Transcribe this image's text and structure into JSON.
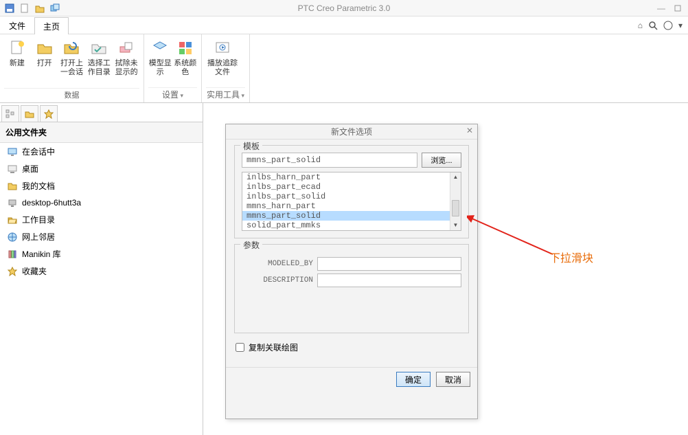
{
  "app": {
    "title": "PTC Creo Parametric 3.0"
  },
  "menubar": {
    "tabs": [
      "文件",
      "主页"
    ],
    "active_index": 1
  },
  "ribbon": {
    "groups": [
      {
        "title": "数据",
        "buttons": [
          {
            "label": "新建"
          },
          {
            "label": "打开"
          },
          {
            "label": "打开上一会话"
          },
          {
            "label": "选择工作目录"
          },
          {
            "label": "拭除未显示的"
          }
        ]
      },
      {
        "title": "设置",
        "buttons": [
          {
            "label": "模型显示"
          },
          {
            "label": "系统颜色"
          }
        ]
      },
      {
        "title": "实用工具",
        "buttons": [
          {
            "label": "播放追踪文件"
          }
        ]
      }
    ]
  },
  "sidebar": {
    "header": "公用文件夹",
    "items": [
      {
        "label": "在会话中",
        "icon": "monitor"
      },
      {
        "label": "桌面",
        "icon": "desktop"
      },
      {
        "label": "我的文档",
        "icon": "docs"
      },
      {
        "label": "desktop-6hutt3a",
        "icon": "computer"
      },
      {
        "label": "工作目录",
        "icon": "folder-open"
      },
      {
        "label": "网上邻居",
        "icon": "network"
      },
      {
        "label": "Manikin 库",
        "icon": "library"
      },
      {
        "label": "收藏夹",
        "icon": "favorites"
      }
    ]
  },
  "dialog": {
    "title": "新文件选项",
    "template_label": "模板",
    "template_value": "mmns_part_solid",
    "browse_label": "浏览...",
    "template_list": [
      "inlbs_harn_part",
      "inlbs_part_ecad",
      "inlbs_part_solid",
      "mmns_harn_part",
      "mmns_part_solid",
      "solid_part_mmks"
    ],
    "template_selected_index": 4,
    "params_label": "参数",
    "params": [
      {
        "name": "MODELED_BY",
        "value": ""
      },
      {
        "name": "DESCRIPTION",
        "value": ""
      }
    ],
    "copy_assoc_label": "复制关联绘图",
    "copy_assoc_checked": false,
    "ok": "确定",
    "cancel": "取消"
  },
  "annotation": {
    "text": "下拉滑块"
  }
}
